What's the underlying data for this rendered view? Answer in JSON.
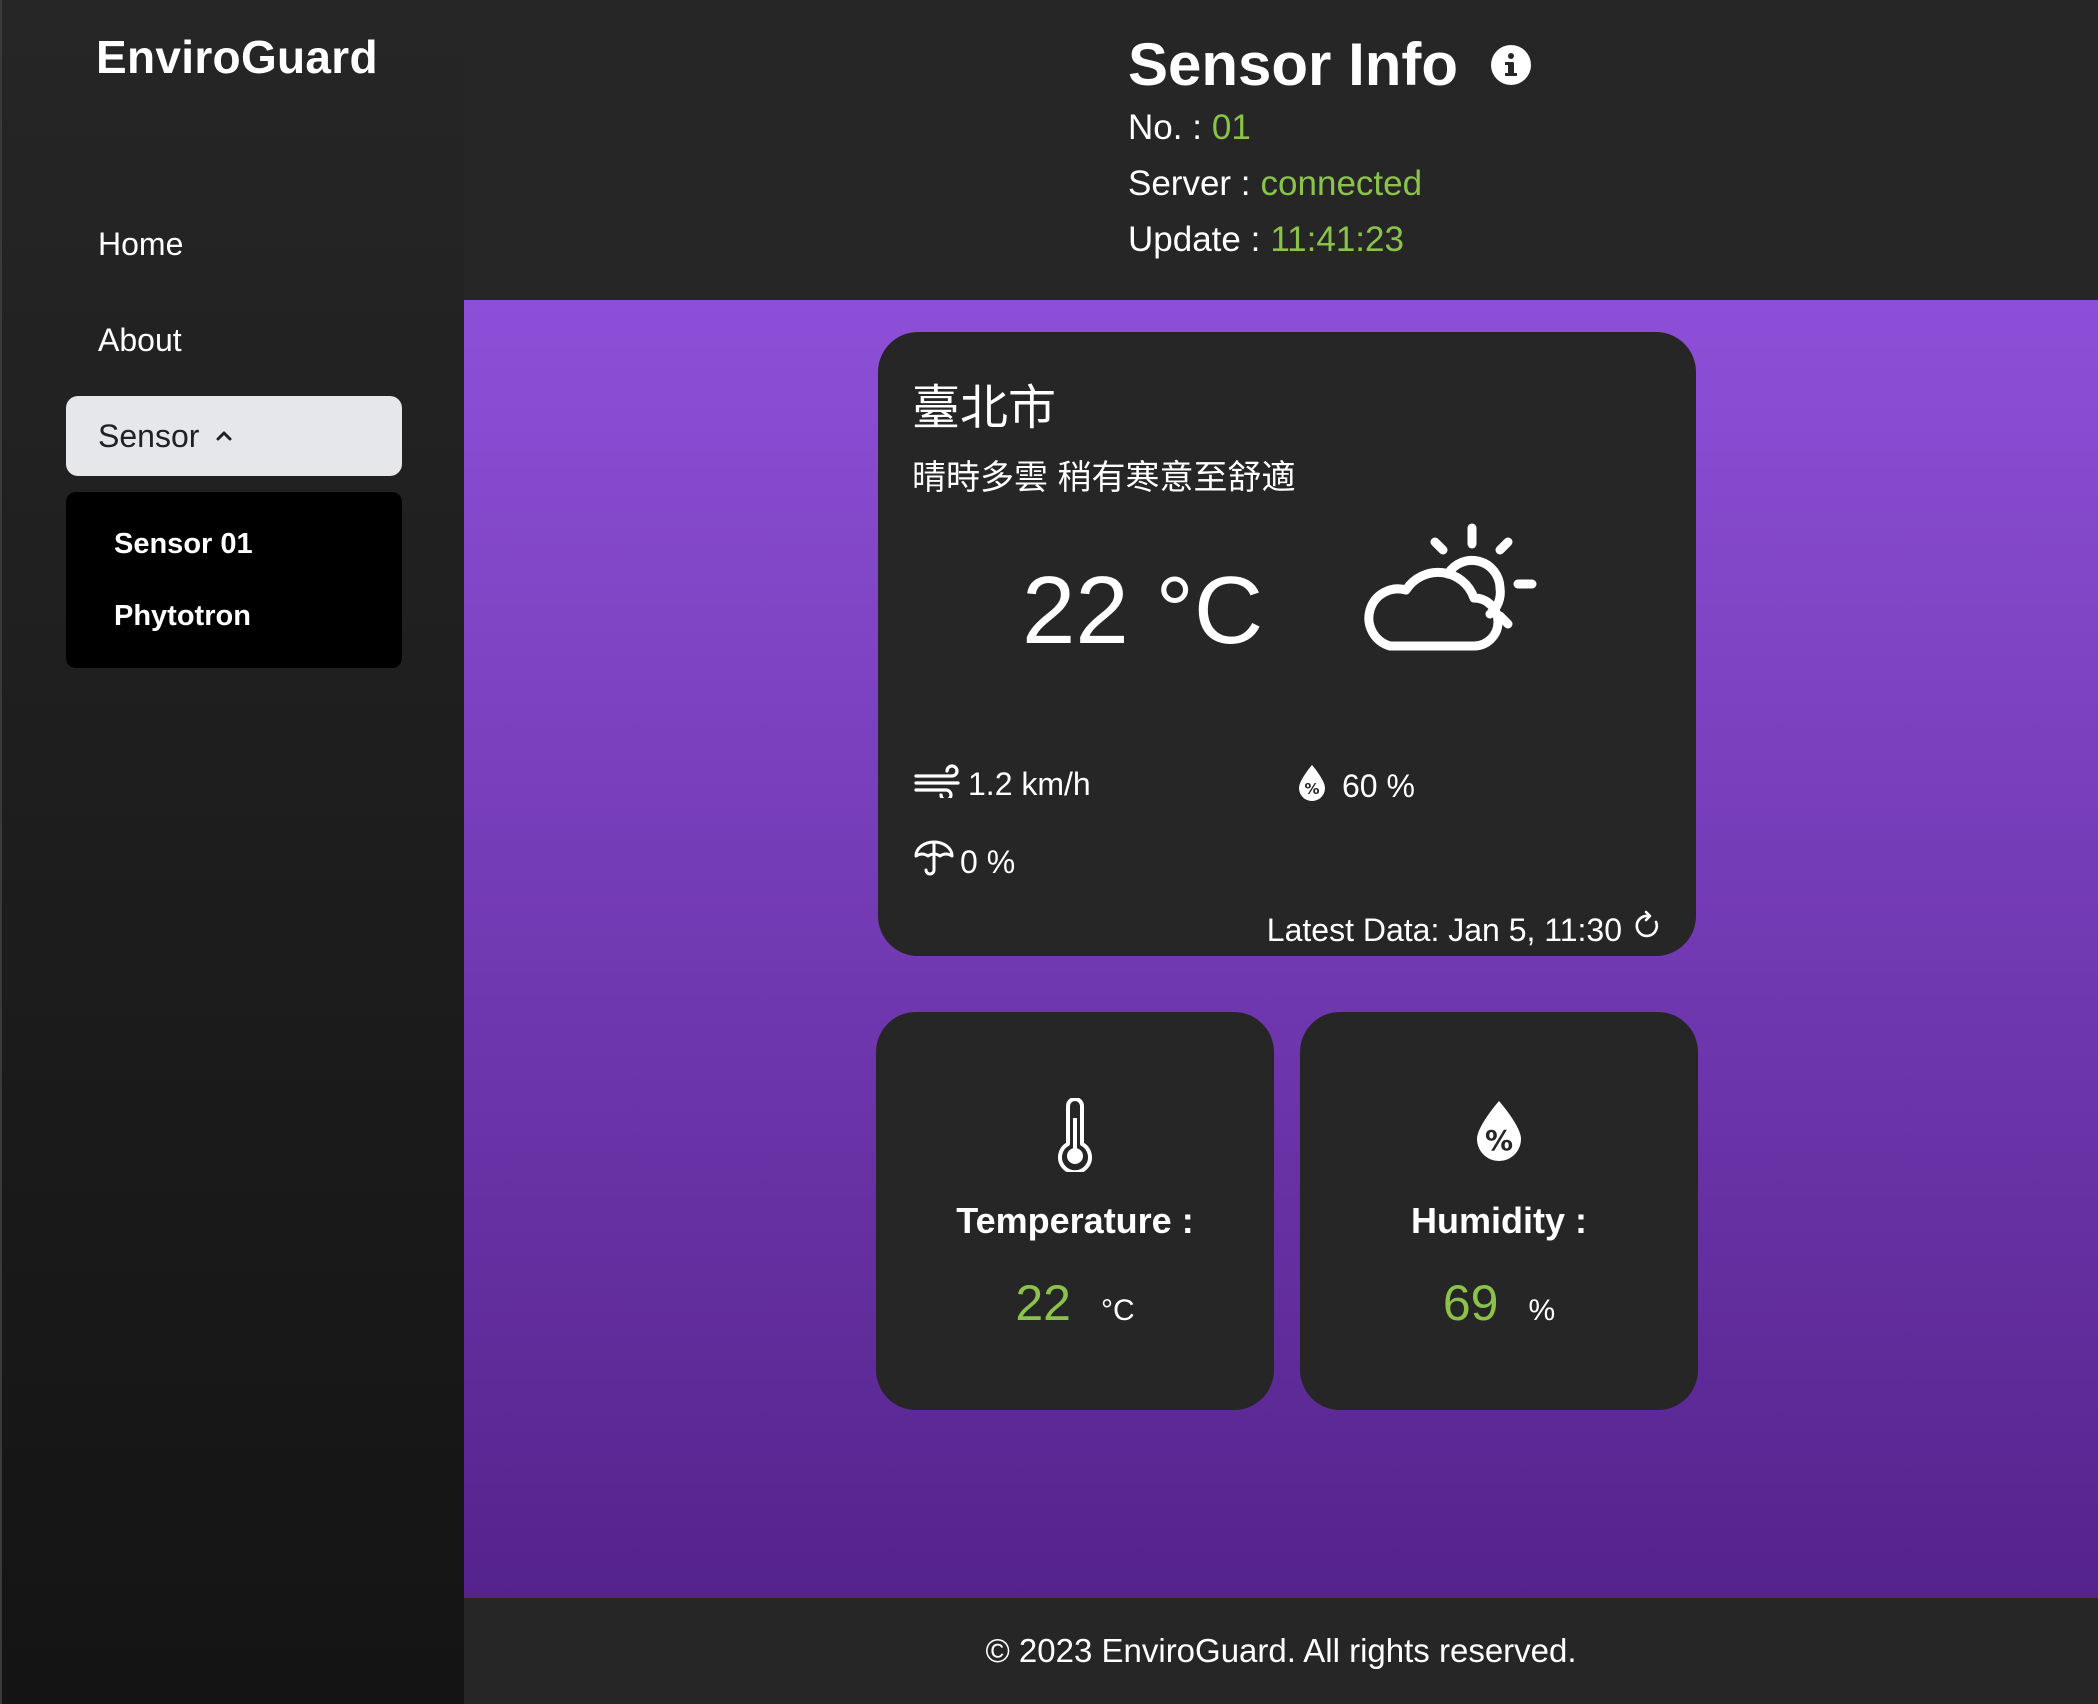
{
  "app": {
    "brand": "EnviroGuard"
  },
  "nav": {
    "home": "Home",
    "about": "About",
    "sensor": "Sensor",
    "submenu": [
      "Sensor 01",
      "Phytotron"
    ]
  },
  "header": {
    "title": "Sensor Info",
    "no_label": "No. :",
    "no_value": "01",
    "server_label": "Server :",
    "server_value": "connected",
    "update_label": "Update :",
    "update_value": "11:41:23"
  },
  "weather": {
    "city": "臺北市",
    "description": "晴時多雲  稍有寒意至舒適",
    "temperature": "22 °C",
    "wind": "1.2 km/h",
    "humidity": "60 %",
    "rain": "0 %",
    "latest": "Latest Data: Jan 5, 11:30",
    "icon": "partly-cloudy-icon"
  },
  "cards": {
    "temperature": {
      "label": "Temperature :",
      "value": "22",
      "unit": "°C",
      "icon": "thermometer-icon"
    },
    "humidity": {
      "label": "Humidity :",
      "value": "69",
      "unit": "%",
      "icon": "humidity-drop-icon"
    }
  },
  "footer": {
    "text": "© 2023 EnviroGuard. All rights reserved."
  },
  "colors": {
    "accent_green": "#8bc34a",
    "card_bg": "#262626",
    "purple_top": "#8e4fd8",
    "purple_bottom": "#55238c"
  }
}
